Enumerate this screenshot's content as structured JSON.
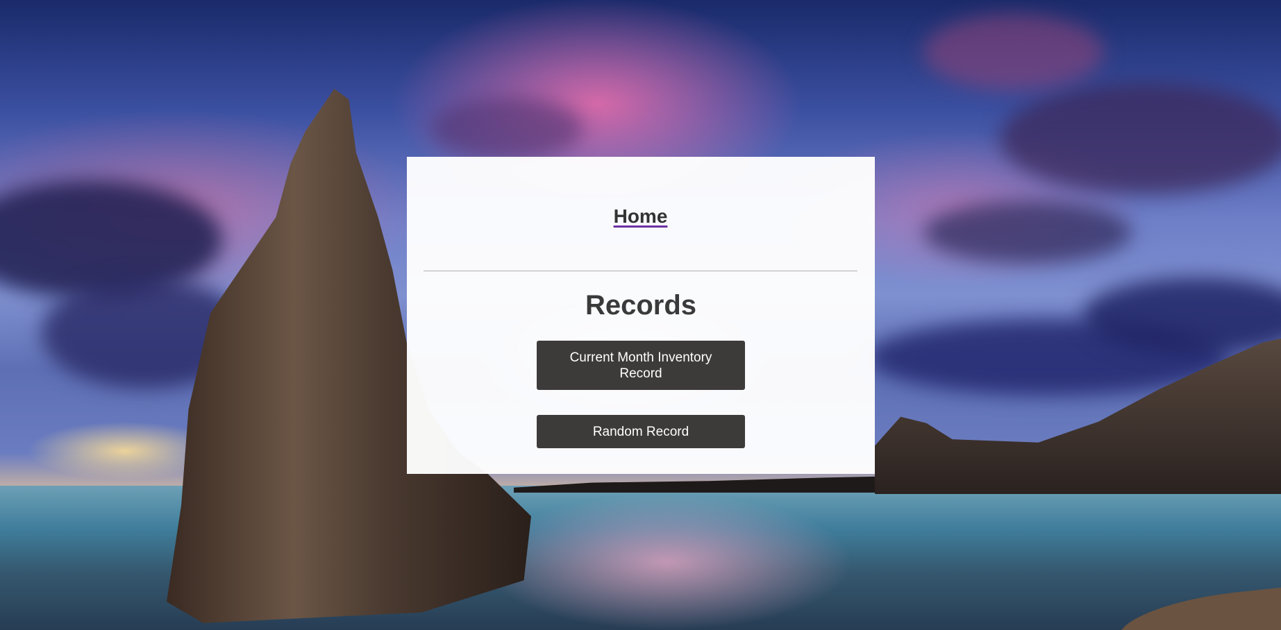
{
  "nav": {
    "home_label": "Home"
  },
  "records": {
    "title": "Records",
    "buttons": {
      "current_month_label": "Current Month Inventory Record",
      "random_label": "Random Record"
    }
  },
  "colors": {
    "panel_background": "#ffffff",
    "button_background": "#3d3b3a",
    "button_text": "#ffffff",
    "link_underline": "#6b2fa0",
    "heading_text": "#3a3a3a"
  }
}
